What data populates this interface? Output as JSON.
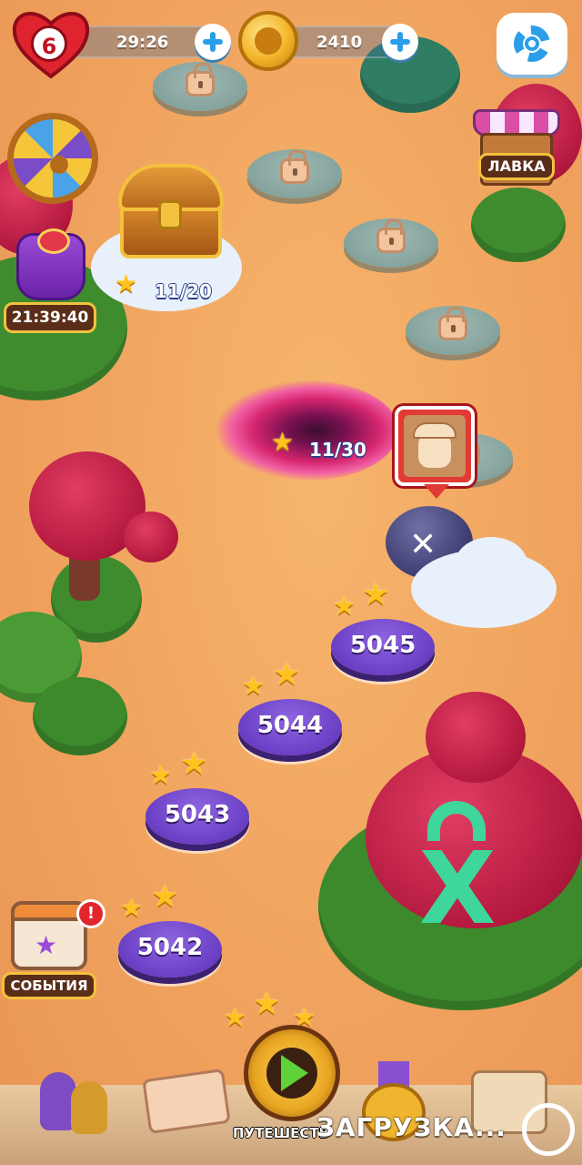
{
  "top_bar": {
    "lives_count": "6",
    "lives_timer": "29:26",
    "coins_count": "2410",
    "colors": {
      "heart": "#e0242f",
      "accent_blue": "#2a9ee8",
      "coin": "#f3b52a"
    }
  },
  "side_left": {
    "chest_progress": "11/20",
    "bundle_timer": "21:39:40",
    "events_label": "СОБЫТИЯ",
    "events_alert": "!"
  },
  "side_right": {
    "shop_label": "ЛАВКА"
  },
  "map": {
    "portal_progress": "11/30",
    "levels": [
      {
        "number": "5045",
        "stars": 2
      },
      {
        "number": "5044",
        "stars": 2
      },
      {
        "number": "5043",
        "stars": 2
      },
      {
        "number": "5042",
        "stars": 2
      }
    ],
    "current_level_stars": 3
  },
  "bottom_bar": {
    "journey_label": "ПУТЕШЕСТВ",
    "loading_text": "ЗАГРУЗКА..."
  },
  "icons": [
    "heart-icon",
    "plus-icon",
    "coin-icon",
    "gear-icon",
    "fortune-wheel-icon",
    "chest-icon",
    "bag-icon",
    "shop-icon",
    "lock-icon",
    "star-icon",
    "pirate-icon",
    "bomb-icon",
    "calendar-icon",
    "play-icon",
    "friends-icon",
    "mail-icon",
    "medal-icon",
    "map-icon",
    "ship-wheel-icon"
  ]
}
